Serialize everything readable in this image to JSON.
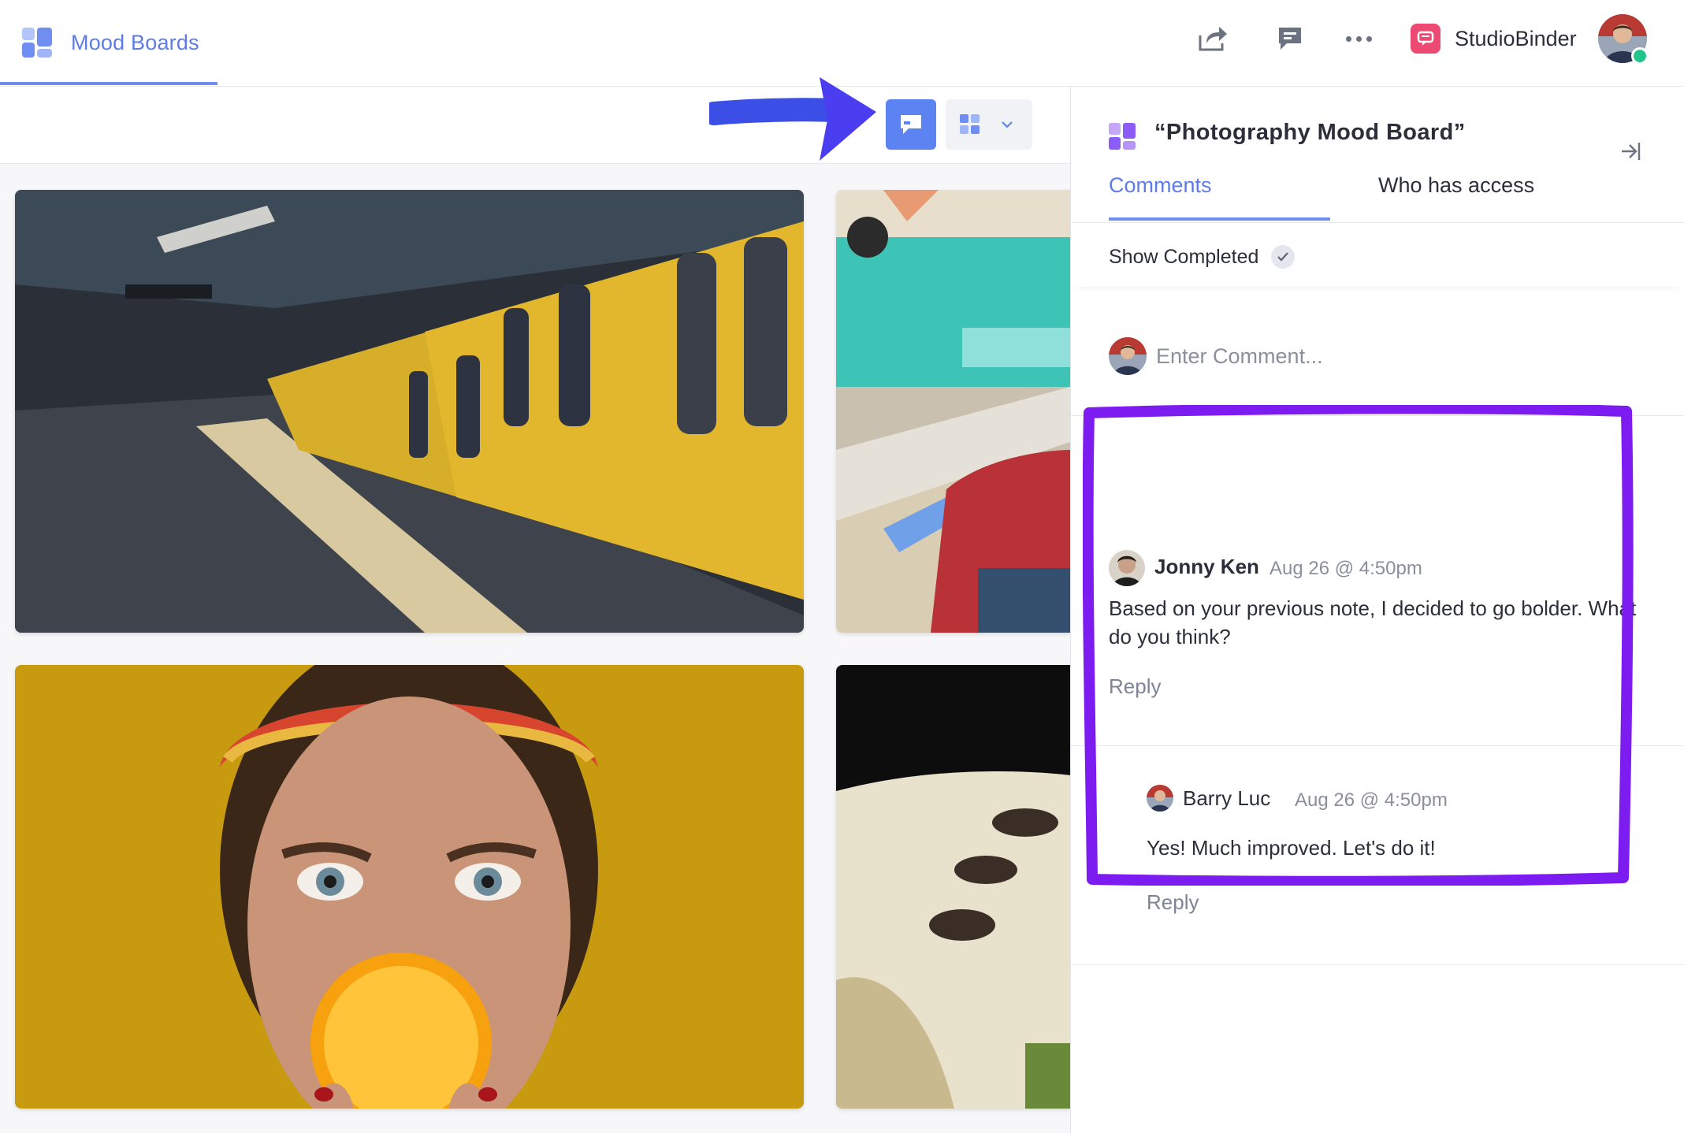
{
  "header": {
    "app_title": "Mood Boards",
    "studio_name": "StudioBinder",
    "icons": [
      "share-icon",
      "comment-icon",
      "more-icon"
    ]
  },
  "board": {
    "tiles": [
      "subway-train",
      "bowling-alley",
      "woman-orange",
      "bowling-ball-return"
    ]
  },
  "panel": {
    "title": "“Photography Mood Board”",
    "tabs": {
      "comments": "Comments",
      "access": "Who has access"
    },
    "show_completed": "Show Completed",
    "comment_placeholder": "Enter Comment...",
    "comments": [
      {
        "author": "Jonny Ken",
        "time": "Aug 26 @ 4:50pm",
        "body": "Based on your previous note, I decided to go bolder. What do you think?",
        "reply": "Reply"
      },
      {
        "author": "Barry Luc",
        "time": "Aug 26 @ 4:50pm",
        "body": "Yes! Much improved. Let's do it!",
        "reply": "Reply"
      }
    ]
  },
  "colors": {
    "accent": "#5d7ce8",
    "button": "#5b84f2",
    "annotation": "#7c1cf0",
    "arrow": "#3b4fe6",
    "online": "#22c58b",
    "studio_logo": "#ec4a72"
  }
}
